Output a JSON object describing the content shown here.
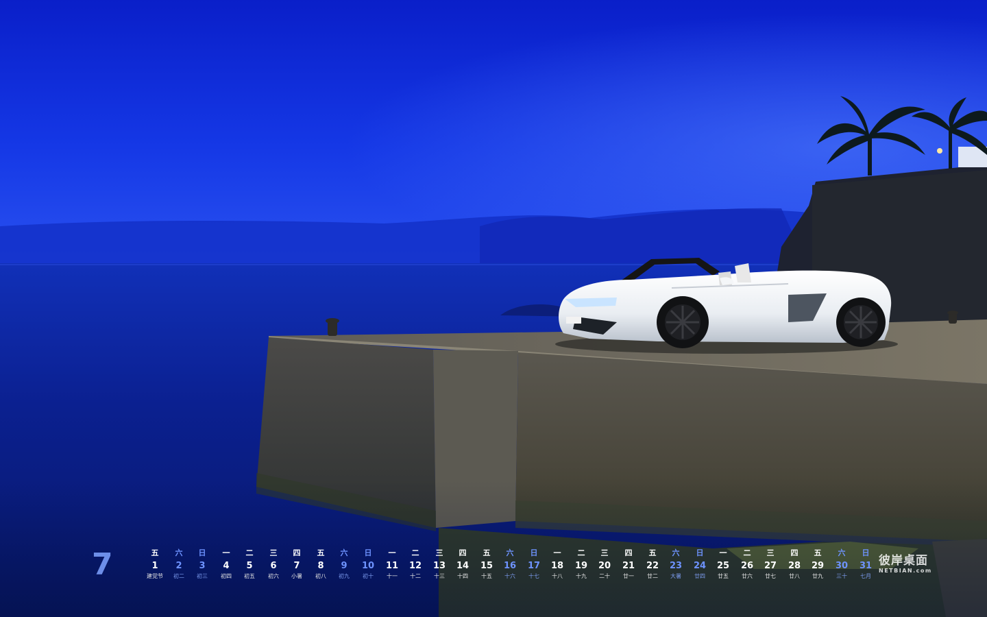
{
  "calendar": {
    "month": "7",
    "days": [
      {
        "weekday": "五",
        "day": "1",
        "lunar": "建党节",
        "weekend": false
      },
      {
        "weekday": "六",
        "day": "2",
        "lunar": "初二",
        "weekend": true
      },
      {
        "weekday": "日",
        "day": "3",
        "lunar": "初三",
        "weekend": true
      },
      {
        "weekday": "一",
        "day": "4",
        "lunar": "初四",
        "weekend": false
      },
      {
        "weekday": "二",
        "day": "5",
        "lunar": "初五",
        "weekend": false
      },
      {
        "weekday": "三",
        "day": "6",
        "lunar": "初六",
        "weekend": false
      },
      {
        "weekday": "四",
        "day": "7",
        "lunar": "小暑",
        "weekend": false
      },
      {
        "weekday": "五",
        "day": "8",
        "lunar": "初八",
        "weekend": false
      },
      {
        "weekday": "六",
        "day": "9",
        "lunar": "初九",
        "weekend": true
      },
      {
        "weekday": "日",
        "day": "10",
        "lunar": "初十",
        "weekend": true
      },
      {
        "weekday": "一",
        "day": "11",
        "lunar": "十一",
        "weekend": false
      },
      {
        "weekday": "二",
        "day": "12",
        "lunar": "十二",
        "weekend": false
      },
      {
        "weekday": "三",
        "day": "13",
        "lunar": "十三",
        "weekend": false
      },
      {
        "weekday": "四",
        "day": "14",
        "lunar": "十四",
        "weekend": false
      },
      {
        "weekday": "五",
        "day": "15",
        "lunar": "十五",
        "weekend": false
      },
      {
        "weekday": "六",
        "day": "16",
        "lunar": "十六",
        "weekend": true
      },
      {
        "weekday": "日",
        "day": "17",
        "lunar": "十七",
        "weekend": true
      },
      {
        "weekday": "一",
        "day": "18",
        "lunar": "十八",
        "weekend": false
      },
      {
        "weekday": "二",
        "day": "19",
        "lunar": "十九",
        "weekend": false
      },
      {
        "weekday": "三",
        "day": "20",
        "lunar": "二十",
        "weekend": false
      },
      {
        "weekday": "四",
        "day": "21",
        "lunar": "廿一",
        "weekend": false
      },
      {
        "weekday": "五",
        "day": "22",
        "lunar": "廿二",
        "weekend": false
      },
      {
        "weekday": "六",
        "day": "23",
        "lunar": "大暑",
        "weekend": true
      },
      {
        "weekday": "日",
        "day": "24",
        "lunar": "廿四",
        "weekend": true
      },
      {
        "weekday": "一",
        "day": "25",
        "lunar": "廿五",
        "weekend": false
      },
      {
        "weekday": "二",
        "day": "26",
        "lunar": "廿六",
        "weekend": false
      },
      {
        "weekday": "三",
        "day": "27",
        "lunar": "廿七",
        "weekend": false
      },
      {
        "weekday": "四",
        "day": "28",
        "lunar": "廿八",
        "weekend": false
      },
      {
        "weekday": "五",
        "day": "29",
        "lunar": "廿九",
        "weekend": false
      },
      {
        "weekday": "六",
        "day": "30",
        "lunar": "三十",
        "weekend": true
      },
      {
        "weekday": "日",
        "day": "31",
        "lunar": "七月",
        "weekend": true
      }
    ]
  },
  "watermark": {
    "chinese": "彼岸桌面",
    "english": "NETBIAN.com"
  },
  "colors": {
    "sky": "#1434e0",
    "sea": "#0f2cb8",
    "pier": "#6b6656",
    "car": "#f4f6f8",
    "weekend_accent": "#6e93ff"
  }
}
